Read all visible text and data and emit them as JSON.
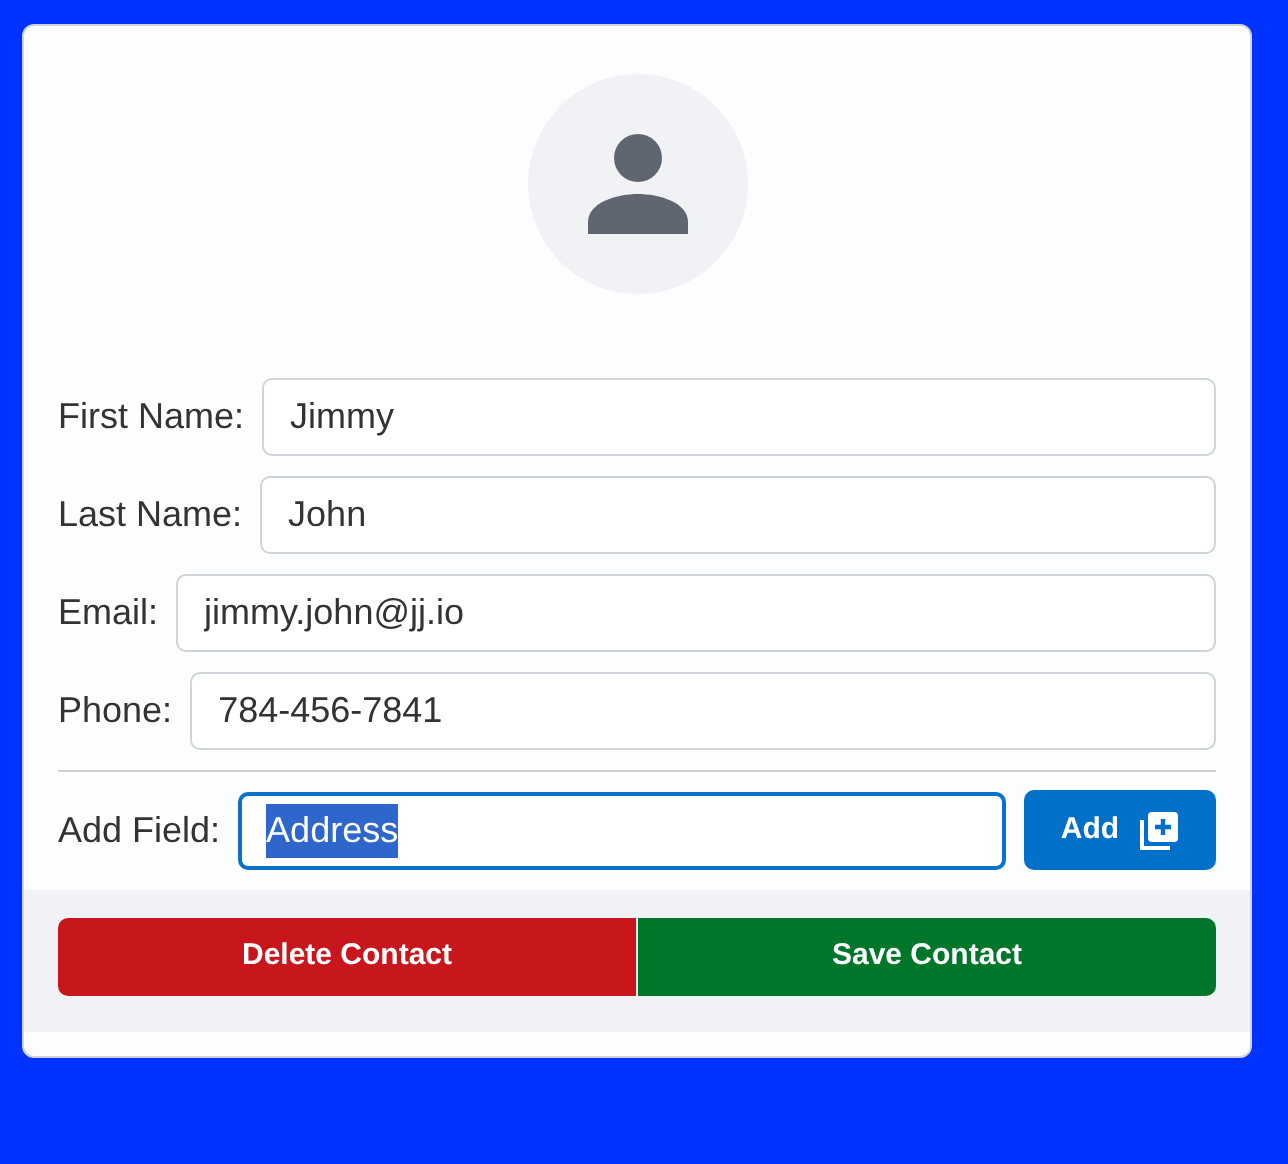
{
  "fields": [
    {
      "label": "First Name:",
      "value": "Jimmy"
    },
    {
      "label": "Last Name:",
      "value": "John"
    },
    {
      "label": "Email:",
      "value": "jimmy.john@jj.io"
    },
    {
      "label": "Phone:",
      "value": "784-456-7841"
    }
  ],
  "add_field": {
    "label": "Add Field:",
    "value": "Address",
    "focused": true,
    "button": "Add"
  },
  "buttons": [
    {
      "label": "Delete Contact",
      "kind": "danger"
    },
    {
      "label": "Save Contact",
      "kind": "success"
    }
  ]
}
